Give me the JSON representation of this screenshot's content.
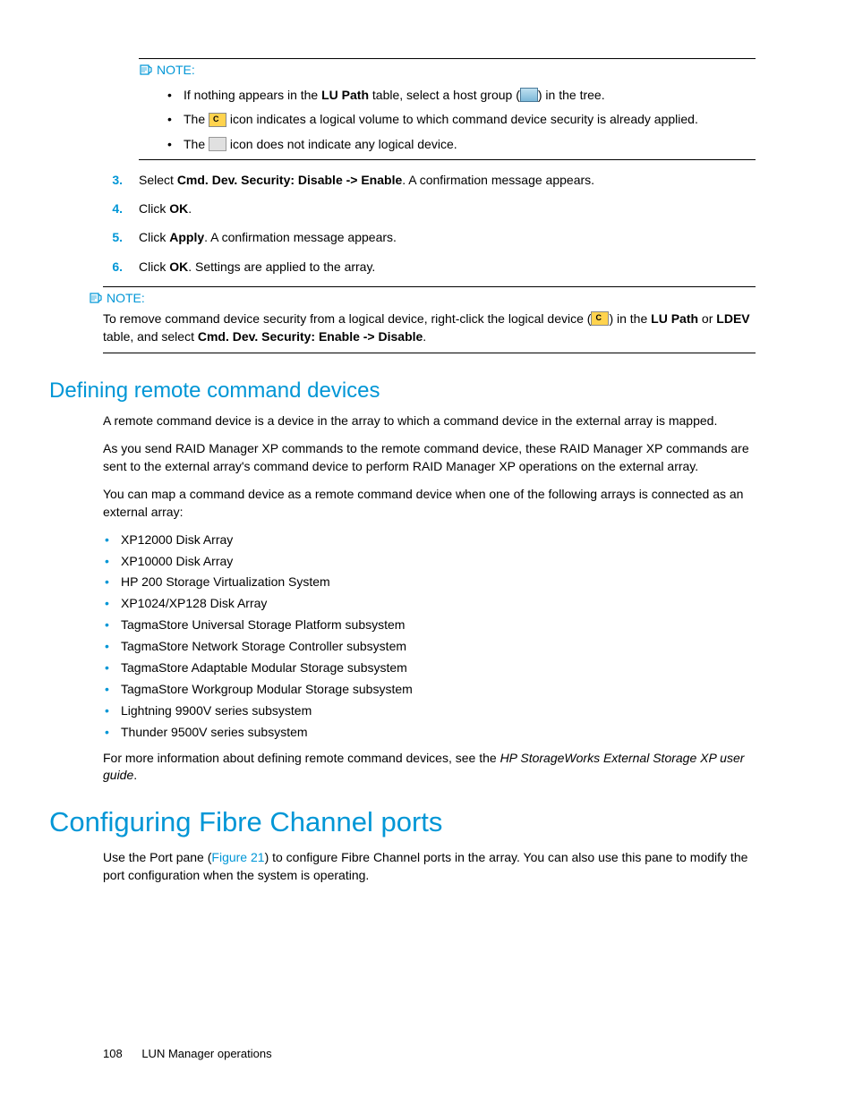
{
  "note1": {
    "label": "NOTE:",
    "bullets": {
      "b1a": "If nothing appears in the ",
      "b1b": "LU Path",
      "b1c": " table, select a host group (",
      "b1d": ") in the tree.",
      "b2a": "The ",
      "b2b": " icon indicates a logical volume to which command device security is already applied.",
      "b3a": "The ",
      "b3b": " icon does not indicate any logical device."
    }
  },
  "steps": {
    "s3": {
      "num": "3.",
      "a": "Select ",
      "b": "Cmd. Dev. Security: Disable -> Enable",
      "c": ". A confirmation message appears."
    },
    "s4": {
      "num": "4.",
      "a": "Click ",
      "b": "OK",
      "c": "."
    },
    "s5": {
      "num": "5.",
      "a": "Click ",
      "b": "Apply",
      "c": ". A confirmation message appears."
    },
    "s6": {
      "num": "6.",
      "a": "Click ",
      "b": "OK",
      "c": ". Settings are applied to the array."
    }
  },
  "note2": {
    "label": "NOTE:",
    "a": "To remove command device security from a logical device, right-click the logical device (",
    "b": ") in the ",
    "c": "LU Path",
    "d": " or ",
    "e": "LDEV",
    "f": " table, and select ",
    "g": "Cmd. Dev. Security: Enable -> Disable",
    "h": "."
  },
  "h2": "Defining remote command devices",
  "p1": "A remote command device is a device in the array to which a command device in the external array is mapped.",
  "p2": "As you send RAID Manager XP commands to the remote command device, these RAID Manager XP commands are sent to the external array's command device to perform RAID Manager XP operations on the external array.",
  "p3": "You can map a command device as a remote command device when one of the following arrays is connected as an external array:",
  "arrays": [
    "XP12000 Disk Array",
    "XP10000 Disk Array",
    "HP 200 Storage Virtualization System",
    "XP1024/XP128 Disk Array",
    "TagmaStore Universal Storage Platform subsystem",
    "TagmaStore Network Storage Controller subsystem",
    "TagmaStore Adaptable Modular Storage subsystem",
    "TagmaStore Workgroup Modular Storage subsystem",
    "Lightning 9900V series subsystem",
    "Thunder 9500V series subsystem"
  ],
  "p4a": "For more information about defining remote command devices, see the ",
  "p4b": "HP StorageWorks External Storage XP user guide",
  "p4c": ".",
  "h1": "Configuring Fibre Channel ports",
  "p5a": "Use the Port pane (",
  "p5b": "Figure 21",
  "p5c": ") to configure Fibre Channel ports in the array. You can also use this pane to modify the port configuration when the system is operating.",
  "footer": {
    "page": "108",
    "title": "LUN Manager operations"
  }
}
